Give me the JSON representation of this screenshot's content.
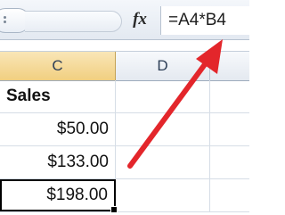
{
  "formula_bar": {
    "fx_label": "fx",
    "formula": "=A4*B4"
  },
  "columns": [
    "C",
    "D"
  ],
  "sheet": {
    "heading": "Sales",
    "values": [
      "$50.00",
      "$133.00",
      "$198.00"
    ],
    "selected_index": 2
  },
  "annotation": {
    "arrow_color": "#e3262b"
  }
}
